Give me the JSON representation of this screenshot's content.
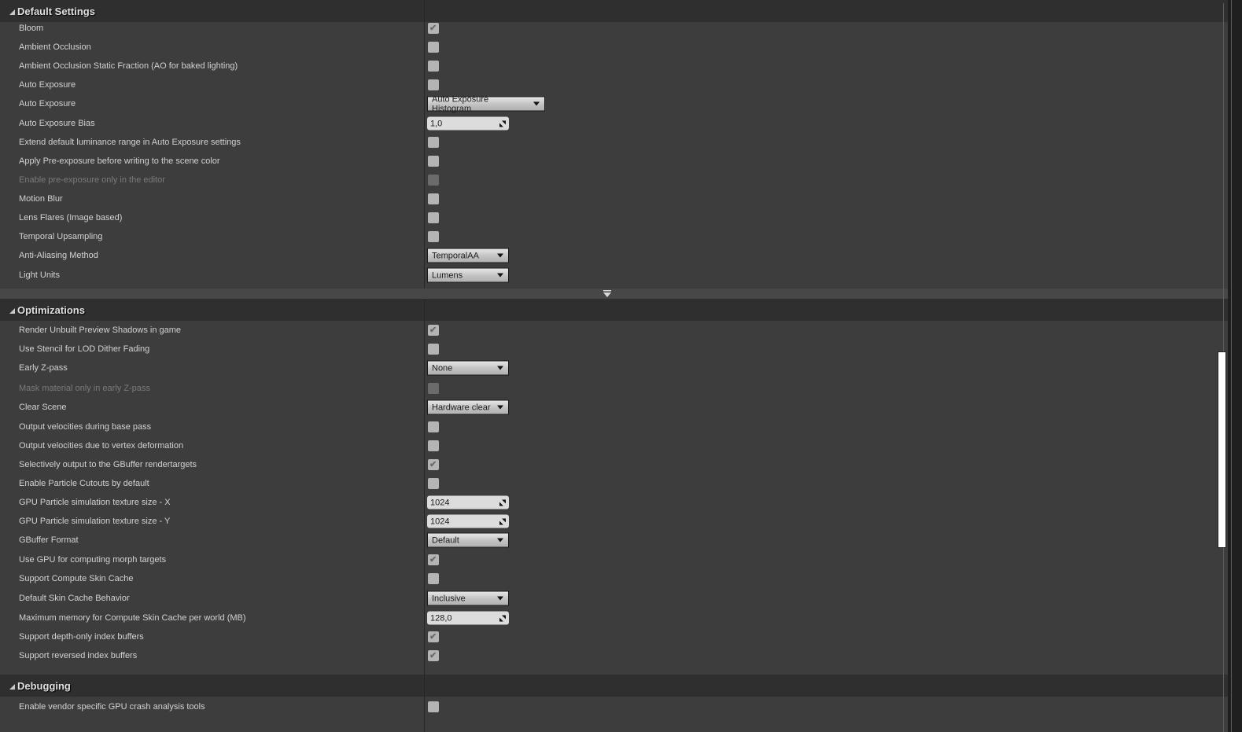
{
  "sections": [
    {
      "title": "Default Settings",
      "rows": [
        {
          "label": "Bloom",
          "type": "checkbox",
          "checked": true
        },
        {
          "label": "Ambient Occlusion",
          "type": "checkbox",
          "checked": false
        },
        {
          "label": "Ambient Occlusion Static Fraction (AO for baked lighting)",
          "type": "checkbox",
          "checked": false
        },
        {
          "label": "Auto Exposure",
          "type": "checkbox",
          "checked": false
        },
        {
          "label": "Auto Exposure",
          "type": "combo",
          "value": "Auto Exposure Histogram"
        },
        {
          "label": "Auto Exposure Bias",
          "type": "number",
          "value": "1,0"
        },
        {
          "label": "Extend default luminance range in Auto Exposure settings",
          "type": "checkbox",
          "checked": false
        },
        {
          "label": "Apply Pre-exposure before writing to the scene color",
          "type": "checkbox",
          "checked": false
        },
        {
          "label": "Enable pre-exposure only in the editor",
          "type": "checkbox",
          "checked": false,
          "disabled": true
        },
        {
          "label": "Motion Blur",
          "type": "checkbox",
          "checked": false
        },
        {
          "label": "Lens Flares (Image based)",
          "type": "checkbox",
          "checked": false
        },
        {
          "label": "Temporal Upsampling",
          "type": "checkbox",
          "checked": false
        },
        {
          "label": "Anti-Aliasing Method",
          "type": "combo",
          "value": "TemporalAA"
        },
        {
          "label": "Light Units",
          "type": "combo",
          "value": "Lumens"
        }
      ]
    },
    {
      "title": "Optimizations",
      "rows": [
        {
          "label": "Render Unbuilt Preview Shadows in game",
          "type": "checkbox",
          "checked": true
        },
        {
          "label": "Use Stencil for LOD Dither Fading",
          "type": "checkbox",
          "checked": false
        },
        {
          "label": "Early Z-pass",
          "type": "combo",
          "value": "None"
        },
        {
          "label": "Mask material only in early Z-pass",
          "type": "checkbox",
          "checked": false,
          "disabled": true
        },
        {
          "label": "Clear Scene",
          "type": "combo",
          "value": "Hardware clear"
        },
        {
          "label": "Output velocities during base pass",
          "type": "checkbox",
          "checked": false
        },
        {
          "label": "Output velocities due to vertex deformation",
          "type": "checkbox",
          "checked": false
        },
        {
          "label": "Selectively output to the GBuffer rendertargets",
          "type": "checkbox",
          "checked": true
        },
        {
          "label": "Enable Particle Cutouts by default",
          "type": "checkbox",
          "checked": false
        },
        {
          "label": "GPU Particle simulation texture size - X",
          "type": "number",
          "value": "1024"
        },
        {
          "label": "GPU Particle simulation texture size - Y",
          "type": "number",
          "value": "1024"
        },
        {
          "label": "GBuffer Format",
          "type": "combo",
          "value": "Default"
        },
        {
          "label": "Use GPU for computing morph targets",
          "type": "checkbox",
          "checked": true
        },
        {
          "label": "Support Compute Skin Cache",
          "type": "checkbox",
          "checked": false
        },
        {
          "label": "Default Skin Cache Behavior",
          "type": "combo",
          "value": "Inclusive"
        },
        {
          "label": "Maximum memory for Compute Skin Cache per world (MB)",
          "type": "number",
          "value": "128,0"
        },
        {
          "label": "Support depth-only index buffers",
          "type": "checkbox",
          "checked": true
        },
        {
          "label": "Support reversed index buffers",
          "type": "checkbox",
          "checked": true
        }
      ]
    },
    {
      "title": "Debugging",
      "rows": [
        {
          "label": "Enable vendor specific GPU crash analysis tools",
          "type": "checkbox",
          "checked": false
        }
      ]
    }
  ],
  "icons": {
    "section_collapse": "collapse-triangle-icon",
    "checkmark": "✔",
    "advanced_expander": "expand-advanced-icon",
    "combo_arrow": "chevron-down-icon",
    "numeric_spin": "drag-spin-icon"
  }
}
